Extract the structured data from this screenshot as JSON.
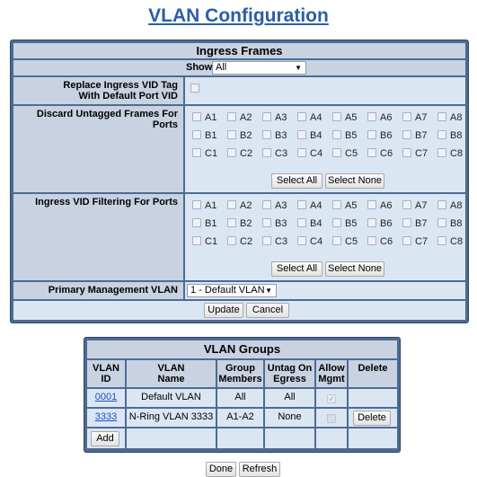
{
  "page": {
    "title": "VLAN Configuration"
  },
  "ingress": {
    "header": "Ingress Frames",
    "show_label": "Show",
    "show_value": "All",
    "replace_label_line1": "Replace Ingress VID Tag",
    "replace_label_line2": "With Default Port VID",
    "replace_checked": false,
    "discard_label": "Discard Untagged Frames For Ports",
    "filter_label": "Ingress VID Filtering For Ports",
    "ports": [
      [
        "A1",
        "A2",
        "A3",
        "A4",
        "A5",
        "A6",
        "A7",
        "A8"
      ],
      [
        "B1",
        "B2",
        "B3",
        "B4",
        "B5",
        "B6",
        "B7",
        "B8"
      ],
      [
        "C1",
        "C2",
        "C3",
        "C4",
        "C5",
        "C6",
        "C7",
        "C8"
      ]
    ],
    "select_all": "Select All",
    "select_none": "Select None",
    "mgmt_label": "Primary Management VLAN",
    "mgmt_value": "1 - Default VLAN",
    "update": "Update",
    "cancel": "Cancel"
  },
  "groups": {
    "header": "VLAN Groups",
    "columns": [
      "VLAN ID",
      "VLAN Name",
      "Group Members",
      "Untag On Egress",
      "Allow Mgmt",
      "Delete"
    ],
    "col_lines": [
      [
        "VLAN",
        "ID"
      ],
      [
        "VLAN",
        "Name"
      ],
      [
        "Group",
        "Members"
      ],
      [
        "Untag On",
        "Egress"
      ],
      [
        "Allow",
        "Mgmt"
      ],
      [
        "Delete"
      ]
    ],
    "rows": [
      {
        "id": "0001",
        "name": "Default VLAN",
        "members": "All",
        "untag": "All",
        "allow_mgmt": true,
        "delete": ""
      },
      {
        "id": "3333",
        "name": "N-Ring VLAN 3333",
        "members": "A1-A2",
        "untag": "None",
        "allow_mgmt": false,
        "delete": "Delete"
      }
    ],
    "add": "Add"
  },
  "footer": {
    "done": "Done",
    "refresh": "Refresh"
  }
}
